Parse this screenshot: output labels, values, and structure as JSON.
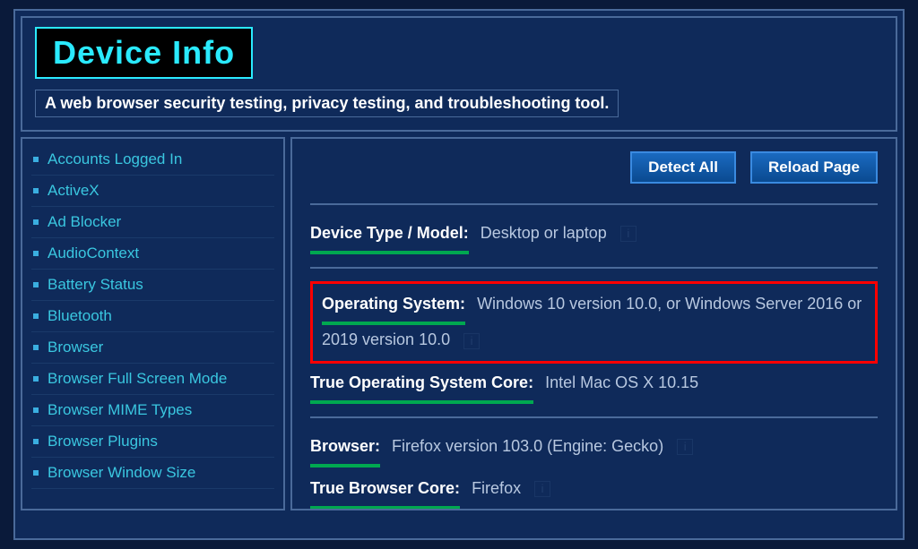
{
  "header": {
    "logo_text": "Device Info",
    "subtitle": "A web browser security testing, privacy testing, and troubleshooting tool."
  },
  "sidebar": {
    "items": [
      {
        "label": "Accounts Logged In"
      },
      {
        "label": "ActiveX"
      },
      {
        "label": "Ad Blocker"
      },
      {
        "label": "AudioContext"
      },
      {
        "label": "Battery Status"
      },
      {
        "label": "Bluetooth"
      },
      {
        "label": "Browser"
      },
      {
        "label": "Browser Full Screen Mode"
      },
      {
        "label": "Browser MIME Types"
      },
      {
        "label": "Browser Plugins"
      },
      {
        "label": "Browser Window Size"
      }
    ]
  },
  "main": {
    "buttons": {
      "detect_all": "Detect All",
      "reload_page": "Reload Page"
    },
    "device_type_label": "Device Type / Model:",
    "device_type_value": "Desktop or laptop",
    "os_label": "Operating System:",
    "os_value": "Windows 10 version 10.0, or Windows Server 2016 or 2019 version 10.0",
    "true_os_label": "True Operating System Core:",
    "true_os_value": "Intel Mac OS X 10.15",
    "browser_label": "Browser:",
    "browser_value": "Firefox version 103.0 (Engine: Gecko)",
    "true_browser_label": "True Browser Core:",
    "true_browser_value": "Firefox"
  }
}
